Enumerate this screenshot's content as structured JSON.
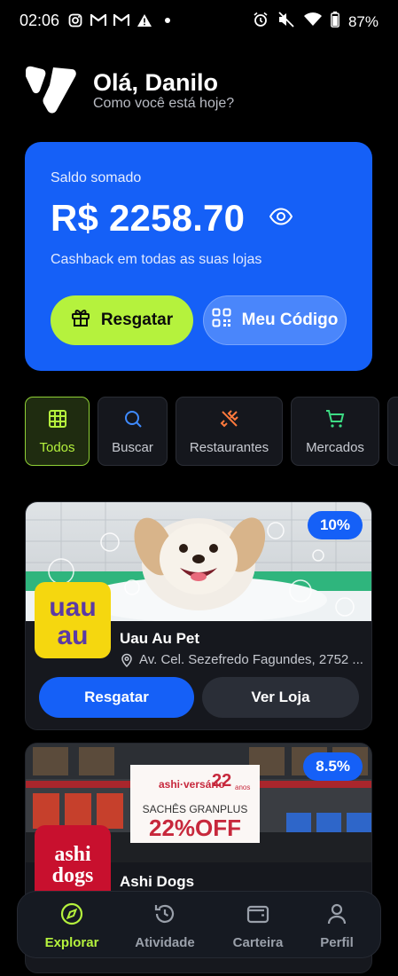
{
  "status_bar": {
    "time": "02:06",
    "battery": "87%",
    "left_icons": [
      "instagram-icon",
      "gmail-icon",
      "gmail-icon",
      "warning-icon",
      "dot-icon"
    ],
    "right_icons": [
      "alarm-icon",
      "mute-icon",
      "wifi-icon",
      "battery-icon"
    ]
  },
  "header": {
    "greeting": "Olá, Danilo",
    "subtitle": "Como você está hoje?"
  },
  "balance": {
    "label": "Saldo somado",
    "value": "R$ 2258.70",
    "cashback_text": "Cashback em todas as suas lojas",
    "redeem_label": "Resgatar",
    "code_label": "Meu Código",
    "accent_color": "#1560f7",
    "redeem_color": "#b5f23d"
  },
  "categories": [
    {
      "label": "Todos",
      "icon": "grid-icon",
      "active": true
    },
    {
      "label": "Buscar",
      "icon": "search-icon",
      "active": false
    },
    {
      "label": "Restaurantes",
      "icon": "utensils-icon",
      "active": false
    },
    {
      "label": "Mercados",
      "icon": "cart-icon",
      "active": false
    }
  ],
  "stores": [
    {
      "name": "Uau Au Pet",
      "address": "Av. Cel. Sezefredo Fagundes, 2752 ...",
      "cashback": "10%",
      "logo_text_line1": "uau",
      "logo_text_line2": "au",
      "redeem_label": "Resgatar",
      "view_label": "Ver Loja"
    },
    {
      "name": "Ashi Dogs",
      "cashback": "8.5%",
      "logo_text_line1": "ashi",
      "logo_text_line2": "dogs",
      "promo_line1": "ashi·versário",
      "promo_line2": "22",
      "promo_line3": "anos",
      "promo_line4": "SACHÊS GRANPLUS",
      "promo_line5": "22%OFF"
    }
  ],
  "bottom_nav": [
    {
      "label": "Explorar",
      "icon": "compass-icon",
      "active": true
    },
    {
      "label": "Atividade",
      "icon": "history-icon",
      "active": false
    },
    {
      "label": "Carteira",
      "icon": "wallet-icon",
      "active": false
    },
    {
      "label": "Perfil",
      "icon": "user-icon",
      "active": false
    }
  ]
}
